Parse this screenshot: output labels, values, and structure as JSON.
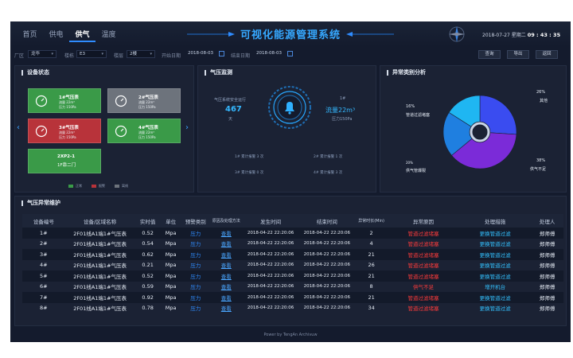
{
  "header": {
    "nav": [
      "首页",
      "供电",
      "供气",
      "温度"
    ],
    "active_nav": "供气",
    "title": "可视化能源管理系统",
    "date": "2018-07-27 星期二",
    "time": "09 : 43 : 35"
  },
  "filters": {
    "factory_label": "厂区",
    "factory_value": "龙华",
    "building_label": "楼栋",
    "building_value": "E3",
    "floor_label": "楼层",
    "floor_value": "2楼",
    "start_label": "开始日期",
    "start_value": "2018-08-03",
    "end_label": "结束日期",
    "end_value": "2018-08-03",
    "buttons": [
      "查询",
      "导出",
      "返回"
    ]
  },
  "device_status": {
    "title": "设备状态",
    "cards": [
      {
        "name": "1#气压表",
        "line1": "流量 22m³",
        "line2": "压力 150Pa",
        "status": "normal"
      },
      {
        "name": "2#气压表",
        "line1": "流量 22m³",
        "line2": "压力 150Pa",
        "status": "offline"
      },
      {
        "name": "3#气压表",
        "line1": "流量 22m³",
        "line2": "压力 150Pa",
        "status": "alarm"
      },
      {
        "name": "4#气压表",
        "line1": "流量 22m³",
        "line2": "压力 150Pa",
        "status": "normal"
      },
      {
        "name": "2XP2-1",
        "line2": "1F靠二门",
        "status": "normal"
      }
    ],
    "legend": [
      {
        "label": "正常",
        "color": "#3a9a48"
      },
      {
        "label": "报警",
        "color": "#b8333a"
      },
      {
        "label": "离线",
        "color": "#6d737c"
      }
    ]
  },
  "gas_monitor": {
    "title": "气压监测",
    "safe_label": "气压系统安全运行",
    "safe_days": "467",
    "safe_unit": "天",
    "device": "1#",
    "flow": "流量22m³",
    "pressure": "压力150Pa",
    "alarms": [
      "1# 累计报警 3 次",
      "2# 累计报警 1 次",
      "3# 累计报警 0 次",
      "4# 累计报警 3 次"
    ]
  },
  "anomaly": {
    "title": "异常类别分析",
    "labels": [
      {
        "pct": "26%",
        "name": "其他"
      },
      {
        "pct": "16%",
        "name": "管道过滤堵塞"
      },
      {
        "pct": "20%",
        "name": "供气管爆裂"
      },
      {
        "pct": "38%",
        "name": "供气不足"
      }
    ]
  },
  "chart_data": {
    "type": "pie",
    "title": "异常类别分析",
    "slices": [
      {
        "label": "其他",
        "value": 26,
        "color": "#3a4cf0"
      },
      {
        "label": "供气不足",
        "value": 38,
        "color": "#7b2bd8"
      },
      {
        "label": "供气管爆裂",
        "value": 20,
        "color": "#1f7fe0"
      },
      {
        "label": "管道过滤堵塞",
        "value": 16,
        "color": "#1fb6f2"
      }
    ]
  },
  "maintenance": {
    "title": "气压异常维护",
    "columns": [
      "设备编号",
      "设备/区域名称",
      "实时值",
      "单位",
      "预警类别",
      "原因及处理方法",
      "发生时间",
      "结束时间",
      "异常时长(Min)",
      "异常原因",
      "处理措施",
      "处理人"
    ],
    "rows": [
      [
        "1#",
        "2F01线A1端1#气压表",
        "0.52",
        "Mpa",
        "压力",
        "查看",
        "2018-04-22 22:20:06",
        "2018-04-22 22:20:06",
        "2",
        "管道过滤堵塞",
        "更换管道过滤",
        "郑师傅"
      ],
      [
        "2#",
        "2F01线A1端1#气压表",
        "0.54",
        "Mpa",
        "压力",
        "查看",
        "2018-04-22 22:20:06",
        "2018-04-22 22:20:06",
        "4",
        "管道过滤堵塞",
        "更换管道过滤",
        "郑师傅"
      ],
      [
        "3#",
        "2F01线A1端1#气压表",
        "0.62",
        "Mpa",
        "压力",
        "查看",
        "2018-04-22 22:20:06",
        "2018-04-22 22:20:06",
        "21",
        "管道过滤堵塞",
        "更换管道过滤",
        "郑师傅"
      ],
      [
        "4#",
        "2F01线A1端1#气压表",
        "0.21",
        "Mpa",
        "压力",
        "查看",
        "2018-04-22 22:20:06",
        "2018-04-22 22:20:06",
        "26",
        "管道过滤堵塞",
        "更换管道过滤",
        "郑师傅"
      ],
      [
        "5#",
        "2F01线A1端1#气压表",
        "0.52",
        "Mpa",
        "压力",
        "查看",
        "2018-04-22 22:20:06",
        "2018-04-22 22:20:06",
        "21",
        "管道过滤堵塞",
        "更换管道过滤",
        "郑师傅"
      ],
      [
        "6#",
        "2F01线A1端1#气压表",
        "0.59",
        "Mpa",
        "压力",
        "查看",
        "2018-04-22 22:20:06",
        "2018-04-22 22:20:06",
        "8",
        "供气不足",
        "增开机台",
        "郑师傅"
      ],
      [
        "7#",
        "2F01线A1端1#气压表",
        "0.92",
        "Mpa",
        "压力",
        "查看",
        "2018-04-22 22:20:06",
        "2018-04-22 22:20:06",
        "21",
        "管道过滤堵塞",
        "更换管道过滤",
        "郑师傅"
      ],
      [
        "8#",
        "2F01线A1端1#气压表",
        "0.78",
        "Mpa",
        "压力",
        "查看",
        "2018-04-22 22:20:06",
        "2018-04-22 22:20:06",
        "34",
        "管道过滤堵塞",
        "更换管道过滤",
        "郑师傅"
      ]
    ]
  },
  "footer": "Power by TengAn Archivuw"
}
